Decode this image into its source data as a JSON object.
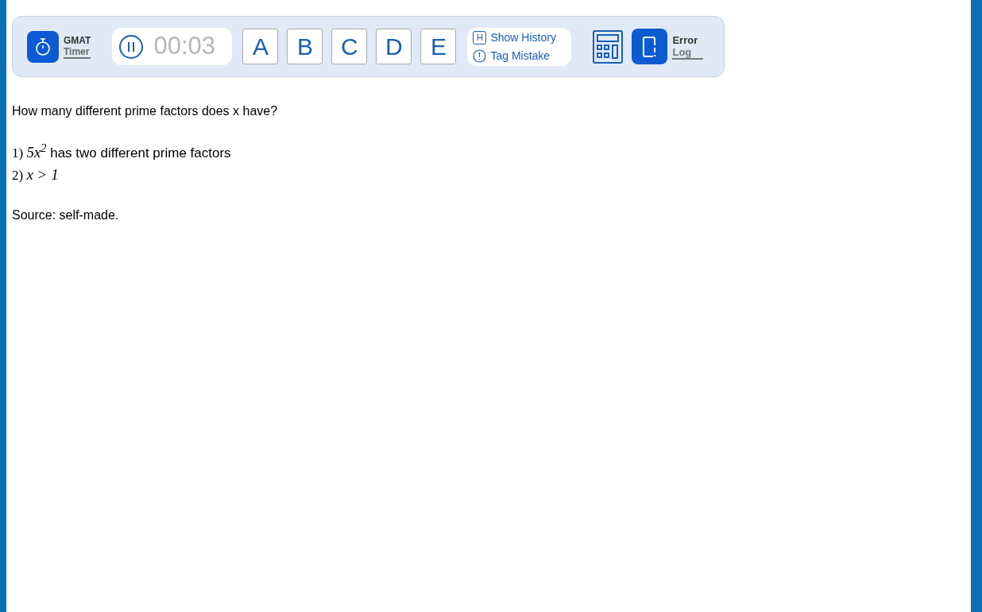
{
  "toolbar": {
    "timer_label": [
      "GMAT",
      "Timer"
    ],
    "time": "00:03",
    "answers": [
      "A",
      "B",
      "C",
      "D",
      "E"
    ],
    "history_key": "H",
    "show_history": "Show History",
    "tag_mistake": "Tag Mistake",
    "error_log": [
      "Error",
      "Log"
    ]
  },
  "question": "How many different prime factors does x have?",
  "statements": [
    {
      "label": "1)",
      "math": "5x$^{2}$",
      "text": "has two different prime factors"
    },
    {
      "label": "2)",
      "math": "x > 1"
    }
  ],
  "source": "Source: self-made."
}
